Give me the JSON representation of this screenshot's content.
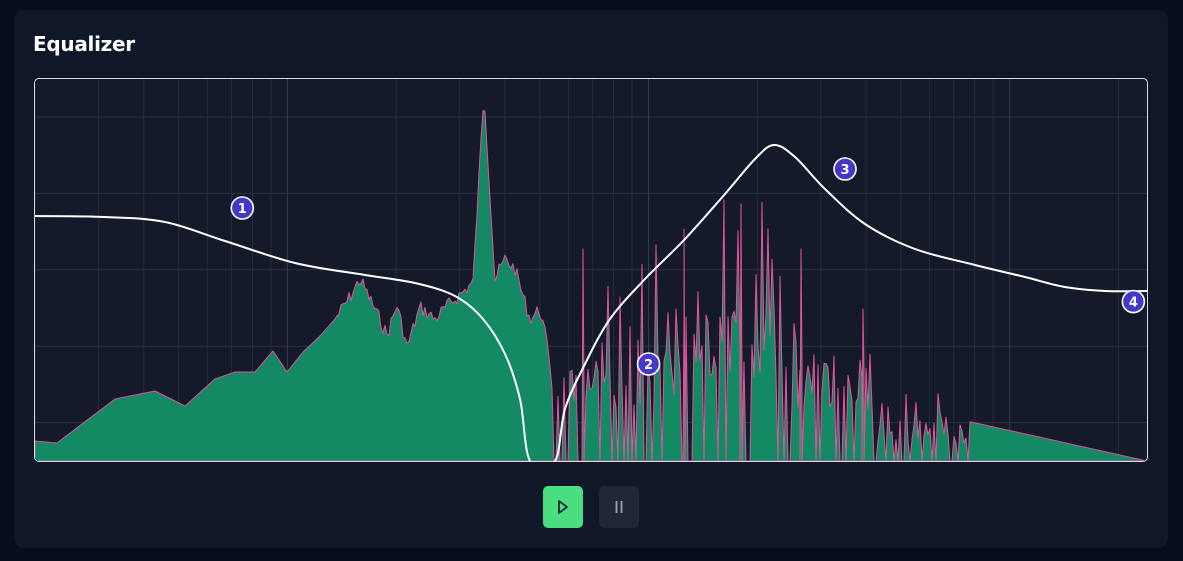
{
  "panel": {
    "title": "Equalizer"
  },
  "eq": {
    "nodes": [
      {
        "label": "1",
        "freq_hz": 75,
        "gain_db": 5
      },
      {
        "label": "2",
        "freq_hz": 1000,
        "gain_db": -15
      },
      {
        "label": "3",
        "freq_hz": 3500,
        "gain_db": 10
      },
      {
        "label": "4",
        "freq_hz": 22000,
        "gain_db": -7
      }
    ],
    "curve_color": "#ffffff",
    "node_color": "#4338ca",
    "spectrum_fill": "#138a64",
    "spectrum_stroke": "#e0529c"
  },
  "controls": {
    "play": {
      "icon": "play-icon",
      "color": "#4ade80"
    },
    "pause": {
      "icon": "pause-icon",
      "color": "#1e2637"
    }
  }
}
